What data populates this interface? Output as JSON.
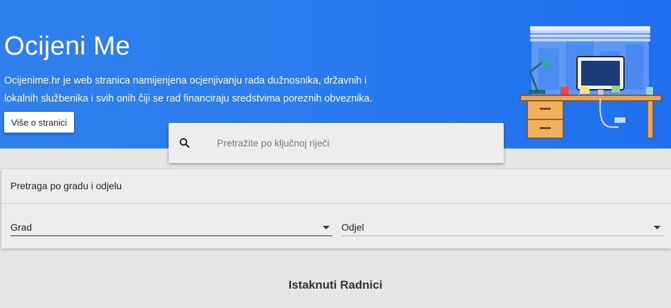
{
  "hero": {
    "title": "Ocijeni Me",
    "description": "Ocijenime.hr je web stranica namijenjena ocjenjivanju rada dužnosnika, državnih i lokalnih službenika i svih onih čiji se rad financiraju sredstvima poreznih obveznika.",
    "more_button": "Više o stranici",
    "background_color": "#2b7df0"
  },
  "search": {
    "placeholder": "Pretražite po ključnoj riječi",
    "icon": "search-icon"
  },
  "filter": {
    "title": "Pretraga po gradu i odjelu",
    "city_select": {
      "label": "Grad"
    },
    "department_select": {
      "label": "Odjel"
    }
  },
  "featured": {
    "title": "Istaknuti Radnici"
  }
}
